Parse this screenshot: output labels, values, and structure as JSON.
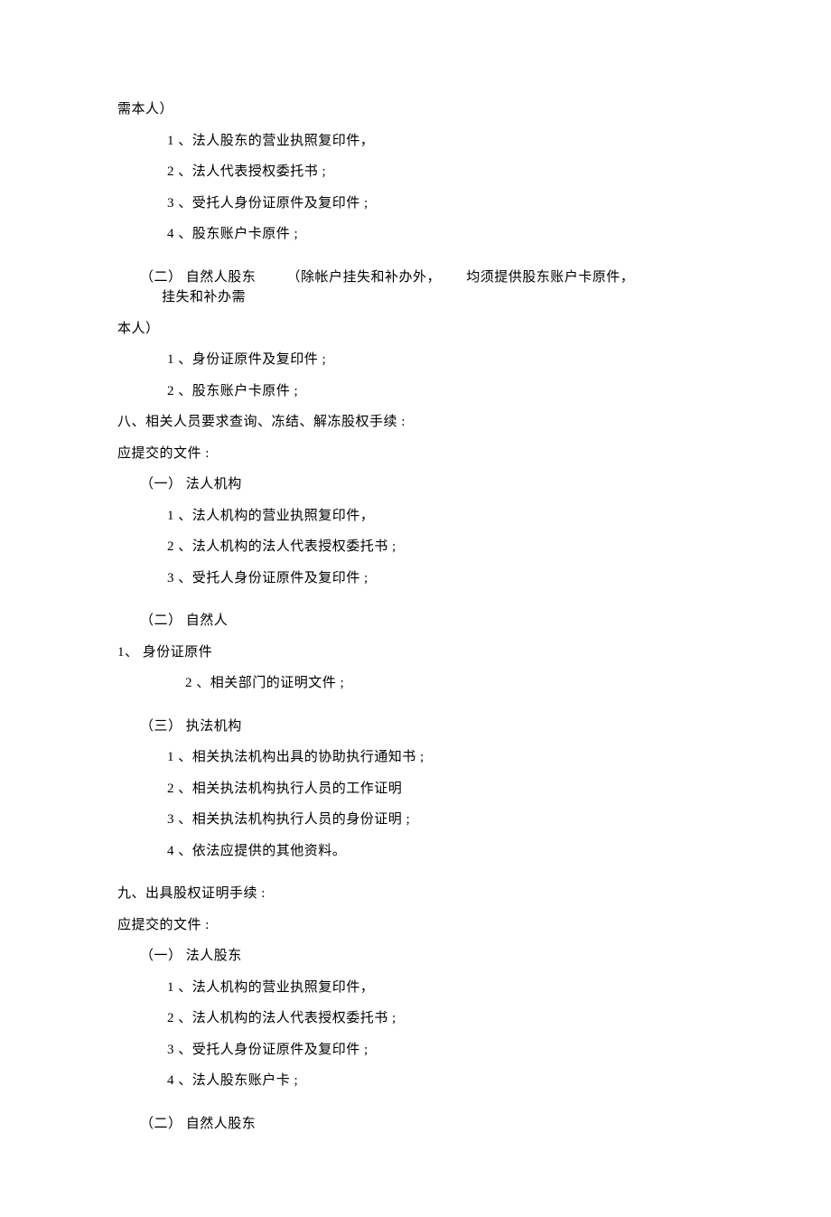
{
  "continuation": "需本人）",
  "group1": {
    "item1": "1 、法人股东的营业执照复印件，",
    "item2": "2 、法人代表授权委托书 ;",
    "item3": "3 、受托人身份证原件及复印件 ;",
    "item4": "4 、股东账户卡原件 ;"
  },
  "sub2": {
    "heading_seg1": "（二） 自然人股东",
    "heading_seg2": "（除帐户挂失和补办外，",
    "heading_seg3": "均须提供股东账户卡原件，",
    "heading_seg4": "挂失和补办需",
    "heading_tail": "本人）",
    "item1": "1 、身份证原件及复印件 ;",
    "item2": "2 、股东账户卡原件 ;"
  },
  "section8": {
    "title": "八、相关人员要求查询、冻结、解冻股权手续 :",
    "subtitle": "应提交的文件 :",
    "part1": {
      "heading": "（一）  法人机构",
      "item1": "1 、法人机构的营业执照复印件，",
      "item2": "2 、法人机构的法人代表授权委托书 ;",
      "item3": "3 、受托人身份证原件及复印件 ;"
    },
    "part2": {
      "heading": "（二）  自然人",
      "row": "1、    身份证原件",
      "item2": "2 、相关部门的证明文件 ;"
    },
    "part3": {
      "heading": "（三）  执法机构",
      "item1": "1 、相关执法机构出具的协助执行通知书 ;",
      "item2": "2 、相关执法机构执行人员的工作证明",
      "item3": "3 、相关执法机构执行人员的身份证明 ;",
      "item4": "4 、依法应提供的其他资料。"
    }
  },
  "section9": {
    "title": "九、出具股权证明手续 :",
    "subtitle": "应提交的文件 :",
    "part1": {
      "heading": "（一）  法人股东",
      "item1": "1 、法人机构的营业执照复印件，",
      "item2": "2 、法人机构的法人代表授权委托书 ;",
      "item3": "3 、受托人身份证原件及复印件 ;",
      "item4": "4 、法人股东账户卡 ;"
    },
    "part2": {
      "heading": "（二） 自然人股东"
    }
  }
}
